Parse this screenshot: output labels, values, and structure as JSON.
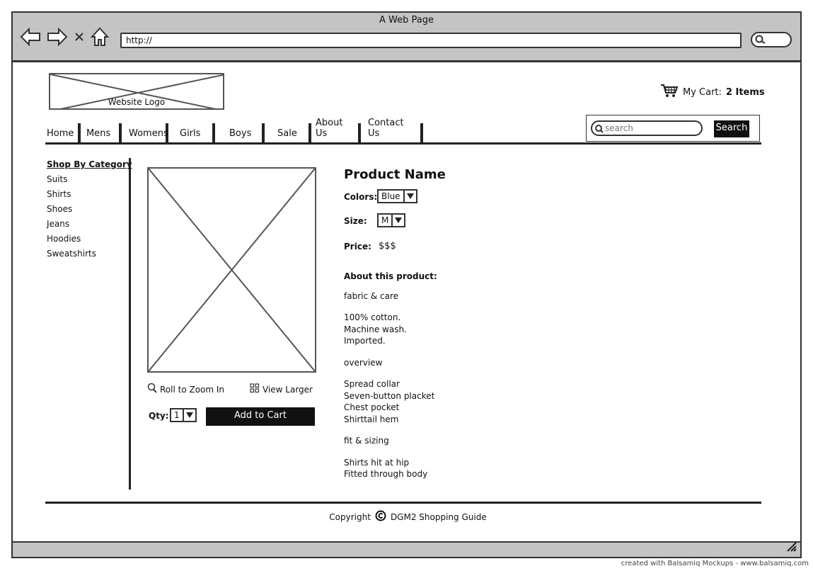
{
  "browser": {
    "title": "A Web Page",
    "url": "http://"
  },
  "logo": {
    "label": "Website Logo"
  },
  "cart": {
    "label": "My Cart:",
    "count": "2 Items"
  },
  "nav": [
    {
      "label": "Home"
    },
    {
      "label": "Mens"
    },
    {
      "label": "Womens"
    },
    {
      "label": "Girls"
    },
    {
      "label": "Boys"
    },
    {
      "label": "Sale"
    },
    {
      "label": "About Us"
    },
    {
      "label": "Contact Us"
    }
  ],
  "search": {
    "placeholder": "search",
    "button": "Search"
  },
  "sidebar": {
    "heading": "Shop By Category",
    "items": [
      "Suits",
      "Shirts",
      "Shoes",
      "Jeans",
      "Hoodies",
      "Sweatshirts"
    ]
  },
  "image_actions": {
    "zoom": "Roll to Zoom In",
    "view_larger": "View Larger"
  },
  "purchase": {
    "qty_label": "Qty:",
    "qty_value": "1",
    "add_to_cart": "Add to Cart"
  },
  "product": {
    "name": "Product Name",
    "colors_label": "Colors:",
    "colors_value": "Blue",
    "size_label": "Size:",
    "size_value": "M",
    "price_label": "Price:",
    "price_value": "$$$",
    "about_heading": "About this product:",
    "fabric_heading": "fabric & care",
    "fabric_lines": [
      "100% cotton.",
      "Machine wash.",
      "Imported."
    ],
    "overview_heading": "overview",
    "overview_lines": [
      "Spread collar",
      "Seven-button placket",
      "Chest pocket",
      "Shirttail hem"
    ],
    "fit_heading": "fit & sizing",
    "fit_lines": [
      "Shirts hit at hip",
      "Fitted through body"
    ]
  },
  "footer": {
    "prefix": "Copyright",
    "owner": "DGM2 Shopping Guide"
  },
  "credit": "created with Balsamiq Mockups - www.balsamiq.com"
}
